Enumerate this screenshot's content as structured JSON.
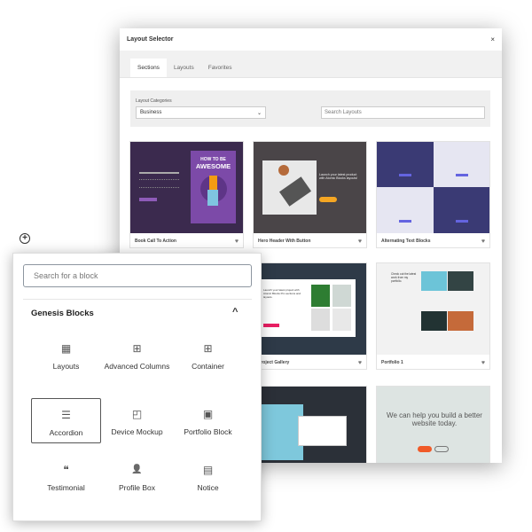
{
  "modal": {
    "title": "Layout Selector",
    "close_icon": "close-icon",
    "tabs": [
      {
        "label": "Sections",
        "active": true
      },
      {
        "label": "Layouts"
      },
      {
        "label": "Favorites"
      }
    ],
    "filters": {
      "category_label": "Layout Categories",
      "category_value": "Business",
      "search_placeholder": "Search Layouts"
    },
    "cards": [
      {
        "title": "Book Call To Action",
        "thumb_text": "HOW TO BE",
        "thumb_text2": "AWESOME"
      },
      {
        "title": "Hero Header With Button",
        "thumb_text": "Launch your latest product with Atomic Blocks layouts!"
      },
      {
        "title": "Alternating Text Blocks"
      },
      {
        "title": "Project Gallery",
        "thumb_text": "Launch your latest project with Atomic Blocks Pro sections and layouts."
      },
      {
        "title": "Portfolio 1",
        "thumb_text": "Check out the latest work from my portfolio."
      },
      {
        "title": ""
      },
      {
        "title": ""
      },
      {
        "title": ""
      },
      {
        "title": "",
        "thumb_text": "We can help you build a better website today."
      }
    ]
  },
  "inserter": {
    "search_placeholder": "Search for a block",
    "category": "Genesis Blocks",
    "blocks": [
      {
        "label": "Layouts",
        "icon": "layouts-icon",
        "glyph": "▦"
      },
      {
        "label": "Advanced Columns",
        "icon": "columns-icon",
        "glyph": "⊞"
      },
      {
        "label": "Container",
        "icon": "container-icon",
        "glyph": "⊞"
      },
      {
        "label": "Accordion",
        "icon": "list-icon",
        "glyph": "☰"
      },
      {
        "label": "Device Mockup",
        "icon": "device-icon",
        "glyph": "◰"
      },
      {
        "label": "Portfolio Block",
        "icon": "gallery-icon",
        "glyph": "▣"
      },
      {
        "label": "Testimonial",
        "icon": "quote-icon",
        "glyph": "❝"
      },
      {
        "label": "Profile Box",
        "icon": "person-icon",
        "glyph": "👤"
      },
      {
        "label": "Notice",
        "icon": "notice-icon",
        "glyph": "▤"
      }
    ]
  },
  "colors": {
    "purple": "#3b2a4e",
    "indigo": "#3a3a74",
    "dark": "#2b3038"
  }
}
